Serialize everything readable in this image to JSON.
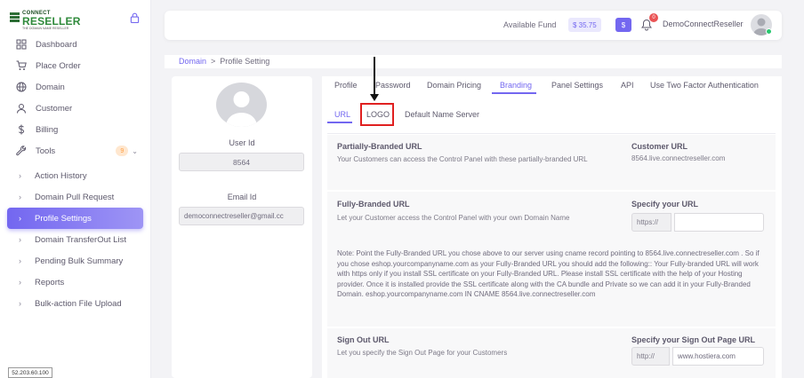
{
  "brand": {
    "line1": "CONNECT",
    "line2": "RESELLER",
    "tagline": "THE DOMAIN NAME RESELLER"
  },
  "sidebar": {
    "items": [
      {
        "label": "Dashboard",
        "icon": "dashboard-icon"
      },
      {
        "label": "Place Order",
        "icon": "cart-icon"
      },
      {
        "label": "Domain",
        "icon": "globe-icon"
      },
      {
        "label": "Customer",
        "icon": "user-icon"
      },
      {
        "label": "Billing",
        "icon": "dollar-icon"
      },
      {
        "label": "Tools",
        "icon": "tools-icon",
        "badge": "9"
      }
    ],
    "subitems": [
      {
        "label": "Action History"
      },
      {
        "label": "Domain Pull Request"
      },
      {
        "label": "Profile Settings",
        "active": true
      },
      {
        "label": "Domain TransferOut List"
      },
      {
        "label": "Pending Bulk Summary"
      },
      {
        "label": "Reports"
      },
      {
        "label": "Bulk-action File Upload"
      }
    ],
    "ip": "52.203.60.100"
  },
  "header": {
    "fund_label": "Available Fund",
    "fund_value": "$ 35.75",
    "dollar_button": "$",
    "notification_count": "0",
    "user_name": "DemoConnectReseller"
  },
  "breadcrumb": {
    "parent": "Domain",
    "separator": ">",
    "current": "Profile Setting"
  },
  "profile": {
    "user_id_label": "User Id",
    "user_id_value": "8564",
    "email_label": "Email Id",
    "email_value": "democonnectreseller@gmail.cc"
  },
  "tabs": [
    "Profile",
    "Password",
    "Domain Pricing",
    "Branding",
    "Panel Settings",
    "API",
    "Use Two Factor Authentication"
  ],
  "active_tab": "Branding",
  "subtabs": [
    "URL",
    "LOGO",
    "Default Name Server"
  ],
  "active_subtab": "URL",
  "branding": {
    "partial_title": "Partially-Branded URL",
    "partial_desc": "Your Customers can access the Control Panel with these partially-branded URL",
    "customer_url_title": "Customer URL",
    "customer_url_value": "8564.live.connectreseller.com",
    "full_title": "Fully-Branded URL",
    "full_desc": "Let your Customer access the Control Panel with your own Domain Name",
    "specify_url_title": "Specify your URL",
    "specify_url_prefix": "https://",
    "specify_url_value": "",
    "note": "Note: Point the Fully-Branded URL you chose above to our server using cname record pointing to 8564.live.connectreseller.com . So if you chose eshop.yourcompanyname.com as your Fully-Branded URL you should add the following:: Your Fully-branded URL will work with https only if you install SSL certificate on your Fully-Branded URL. Please install SSL certificate with the help of your Hosting provider. Once it is installed provide the SSL certificate along with the CA bundle and Private so we can add it in your Fully-Branded Domain. eshop.yourcompanyname.com IN CNAME 8564.live.connectreseller.com",
    "signout_title": "Sign Out URL",
    "signout_desc": "Let you specify the Sign Out Page for your Customers",
    "signout_page_title": "Specify your Sign Out Page URL",
    "signout_prefix": "http://",
    "signout_value": "www.hostiera.com"
  },
  "colors": {
    "accent": "#7367f0",
    "highlight": "#e02020",
    "success": "#28c76f",
    "danger": "#ea5455"
  }
}
